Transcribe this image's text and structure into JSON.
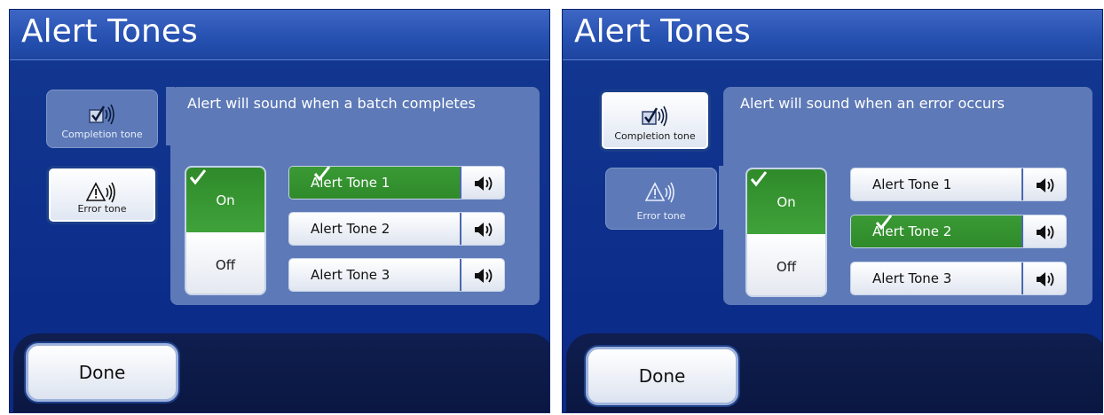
{
  "screens": [
    {
      "title": "Alert Tones",
      "description": "Alert will sound when a batch completes",
      "completion_tab": {
        "label": "Completion tone",
        "active": true
      },
      "error_tab": {
        "label": "Error tone",
        "active": false
      },
      "on_label": "On",
      "off_label": "Off",
      "state": "on",
      "tones": [
        {
          "label": "Alert Tone 1",
          "selected": true
        },
        {
          "label": "Alert Tone 2",
          "selected": false
        },
        {
          "label": "Alert Tone 3",
          "selected": false
        }
      ],
      "done_label": "Done"
    },
    {
      "title": "Alert Tones",
      "description": "Alert will sound when an error occurs",
      "completion_tab": {
        "label": "Completion tone",
        "active": false
      },
      "error_tab": {
        "label": "Error tone",
        "active": true
      },
      "on_label": "On",
      "off_label": "Off",
      "state": "on",
      "tones": [
        {
          "label": "Alert Tone 1",
          "selected": false
        },
        {
          "label": "Alert Tone 2",
          "selected": true
        },
        {
          "label": "Alert Tone 3",
          "selected": false
        }
      ],
      "done_label": "Done"
    }
  ],
  "colors": {
    "background_blue": "#0d2f8f",
    "panel": "#5d79b7",
    "selected_green": "#3a9a35",
    "title_text": "#ffffff"
  },
  "icons": {
    "completion": "checkbox-sound-icon",
    "error": "warning-sound-icon",
    "play": "speaker-icon",
    "selected": "checkmark-icon"
  }
}
